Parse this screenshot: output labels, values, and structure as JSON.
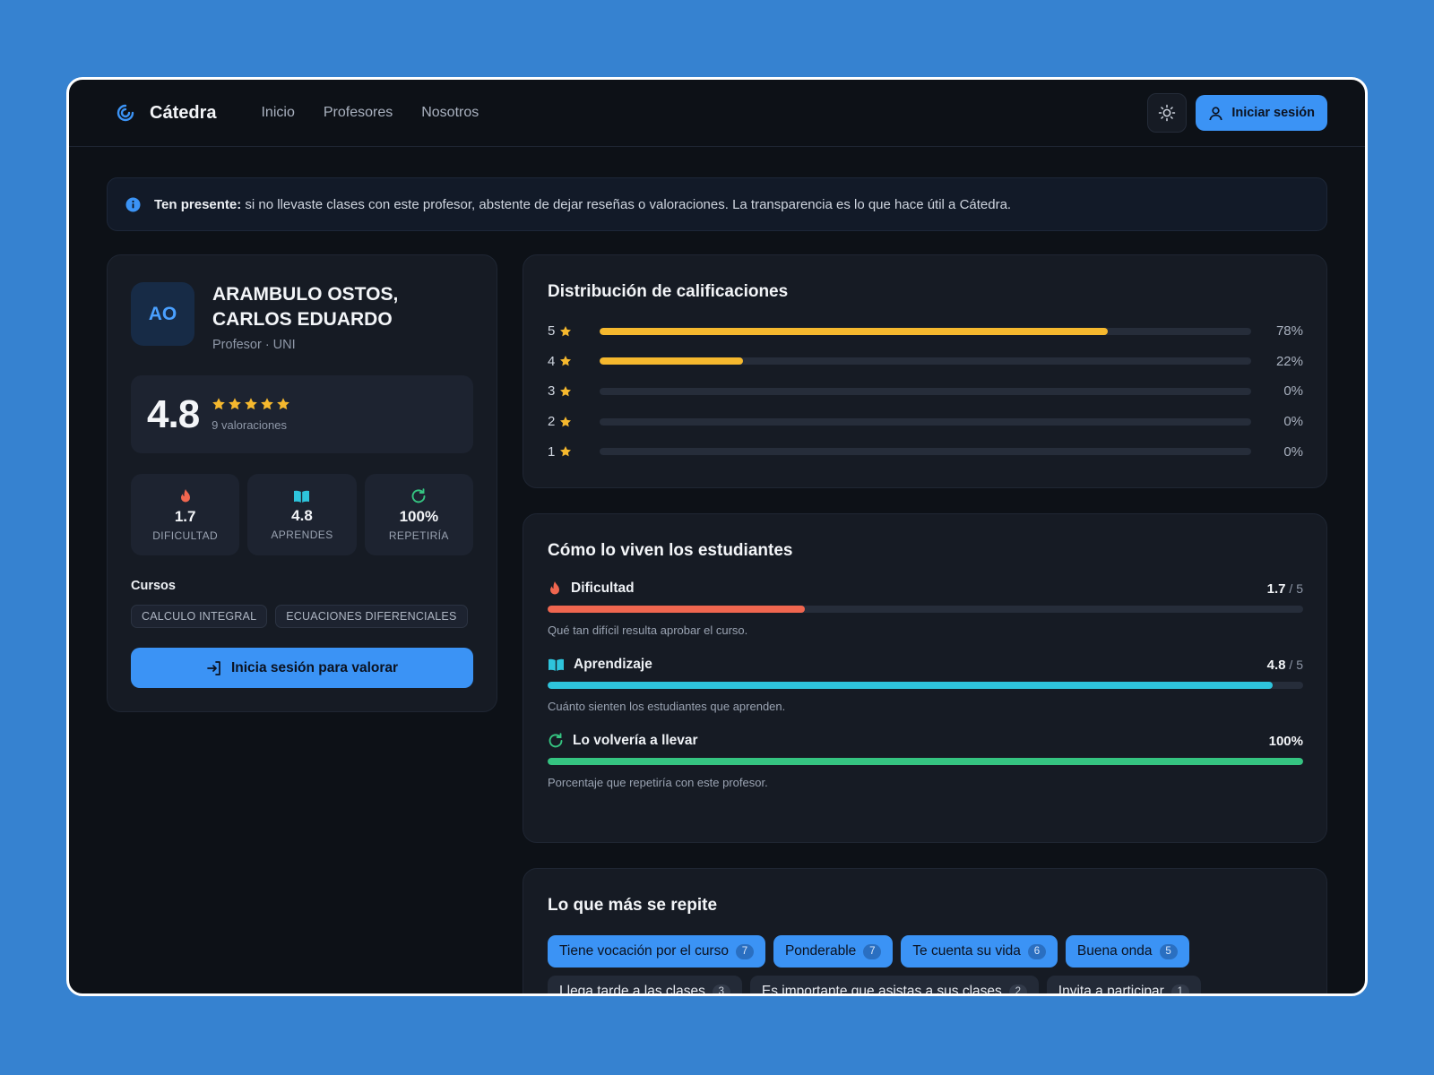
{
  "app": {
    "name": "Cátedra"
  },
  "nav": {
    "items": [
      "Inicio",
      "Profesores",
      "Nosotros"
    ]
  },
  "header": {
    "login_label": "Iniciar sesión"
  },
  "notice": {
    "bold": "Ten presente:",
    "text": " si no llevaste clases con este profesor, abstente de dejar reseñas o valoraciones. La transparencia es lo que hace útil a Cátedra."
  },
  "profile": {
    "initials": "AO",
    "name": "ARAMBULO OSTOS, CARLOS EDUARDO",
    "subtitle": "Profesor · UNI",
    "rating": "4.8",
    "rating_count": "9 valoraciones",
    "stats": [
      {
        "value": "1.7",
        "label": "DIFICULTAD",
        "icon": "flame-icon",
        "color": "#f0664f"
      },
      {
        "value": "4.8",
        "label": "APRENDES",
        "icon": "book-icon",
        "color": "#2ec4dc"
      },
      {
        "value": "100%",
        "label": "REPETIRÍA",
        "icon": "refresh-icon",
        "color": "#35c481"
      }
    ],
    "courses_title": "Cursos",
    "courses": [
      "CALCULO INTEGRAL",
      "ECUACIONES DIFERENCIALES"
    ],
    "rate_button": "Inicia sesión para valorar"
  },
  "distribution": {
    "title": "Distribución de calificaciones",
    "rows": [
      {
        "stars": "5",
        "pct": "78%",
        "value": 0.78
      },
      {
        "stars": "4",
        "pct": "22%",
        "value": 0.22
      },
      {
        "stars": "3",
        "pct": "0%",
        "value": 0
      },
      {
        "stars": "2",
        "pct": "0%",
        "value": 0
      },
      {
        "stars": "1",
        "pct": "0%",
        "value": 0
      }
    ],
    "bar_color": "#f5b82e"
  },
  "experience": {
    "title": "Cómo lo viven los estudiantes",
    "items": [
      {
        "name": "Dificultad",
        "score": "1.7",
        "of": " / 5",
        "value": 0.34,
        "color": "#f0664f",
        "desc": "Qué tan difícil resulta aprobar el curso.",
        "icon": "flame-icon"
      },
      {
        "name": "Aprendizaje",
        "score": "4.8",
        "of": " / 5",
        "value": 0.96,
        "color": "#2ec4dc",
        "desc": "Cuánto sienten los estudiantes que aprenden.",
        "icon": "book-icon"
      },
      {
        "name": "Lo volvería a llevar",
        "score": "100%",
        "of": "",
        "value": 1.0,
        "color": "#35c481",
        "desc": "Porcentaje que repetiría con este profesor.",
        "icon": "refresh-icon"
      }
    ]
  },
  "repeats": {
    "title": "Lo que más se repite",
    "chips": [
      {
        "label": "Tiene vocación por el curso",
        "count": "7",
        "hot": true
      },
      {
        "label": "Ponderable",
        "count": "7",
        "hot": true
      },
      {
        "label": "Te cuenta su vida",
        "count": "6",
        "hot": true
      },
      {
        "label": "Buena onda",
        "count": "5",
        "hot": true
      },
      {
        "label": "Llega tarde a las clases",
        "count": "3",
        "hot": false
      },
      {
        "label": "Es importante que asistas a sus clases",
        "count": "2",
        "hot": false
      },
      {
        "label": "Invita a participar",
        "count": "1",
        "hot": false
      }
    ]
  }
}
